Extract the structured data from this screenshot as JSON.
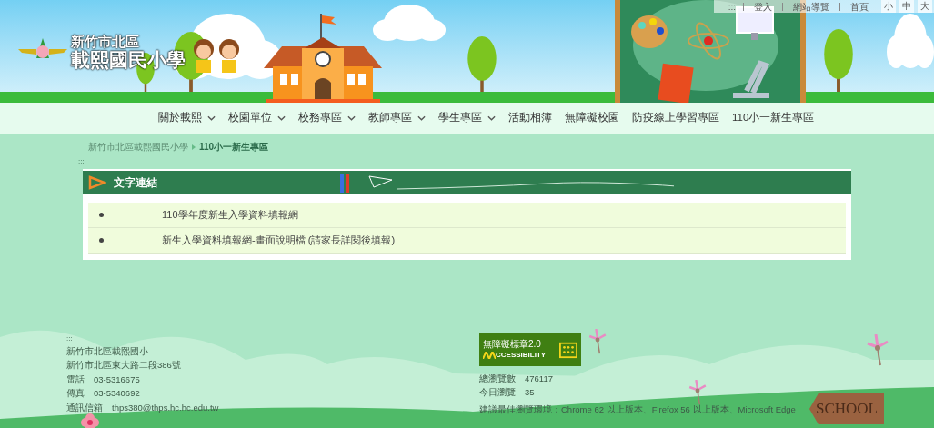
{
  "top_links": {
    "accesskey": ":::",
    "items": [
      "登入",
      "網站導覽",
      "首頁"
    ],
    "font_sizes": [
      "小",
      "中",
      "大"
    ]
  },
  "logo": {
    "line1": "新竹市北區",
    "line2": "載熙國民小學"
  },
  "nav": [
    {
      "label": "關於載熙",
      "has_submenu": true
    },
    {
      "label": "校園單位",
      "has_submenu": true
    },
    {
      "label": "校務專區",
      "has_submenu": true
    },
    {
      "label": "教師專區",
      "has_submenu": true
    },
    {
      "label": "學生專區",
      "has_submenu": true
    },
    {
      "label": "活動相簿",
      "has_submenu": false
    },
    {
      "label": "無障礙校園",
      "has_submenu": false
    },
    {
      "label": "防疫線上學習專區",
      "has_submenu": false
    },
    {
      "label": "110小一新生專區",
      "has_submenu": false
    }
  ],
  "breadcrumb": [
    "新竹市北區載熙國民小學",
    "110小一新生專區"
  ],
  "content_accesskey": ":::",
  "panel": {
    "title": "文字連結",
    "links": [
      "110學年度新生入學資料填報網",
      "新生入學資料填報網-畫面說明檔 (請家長詳閱後填報)"
    ]
  },
  "footer": {
    "accesskey": ":::",
    "name": "新竹市北區載熙國小",
    "address": "新竹市北區東大路二段386號",
    "contacts": [
      {
        "label": "電話",
        "value": "03-5316675"
      },
      {
        "label": "傳真",
        "value": "03-5340692"
      },
      {
        "label": "通訊信箱",
        "value": "thps380@thps.hc.hc.edu.tw"
      }
    ],
    "badge": {
      "line1": "無障礙標章2.0",
      "line2": "CCESSIBILITY"
    },
    "stats": [
      {
        "label": "總瀏覽數",
        "value": "476117"
      },
      {
        "label": "今日瀏覽",
        "value": "35"
      }
    ],
    "browser_note": "建議最佳瀏覽環境：Chrome 62 以上版本、Firefox 56 以上版本、Microsoft Edge",
    "sign": "SCHOOL"
  }
}
